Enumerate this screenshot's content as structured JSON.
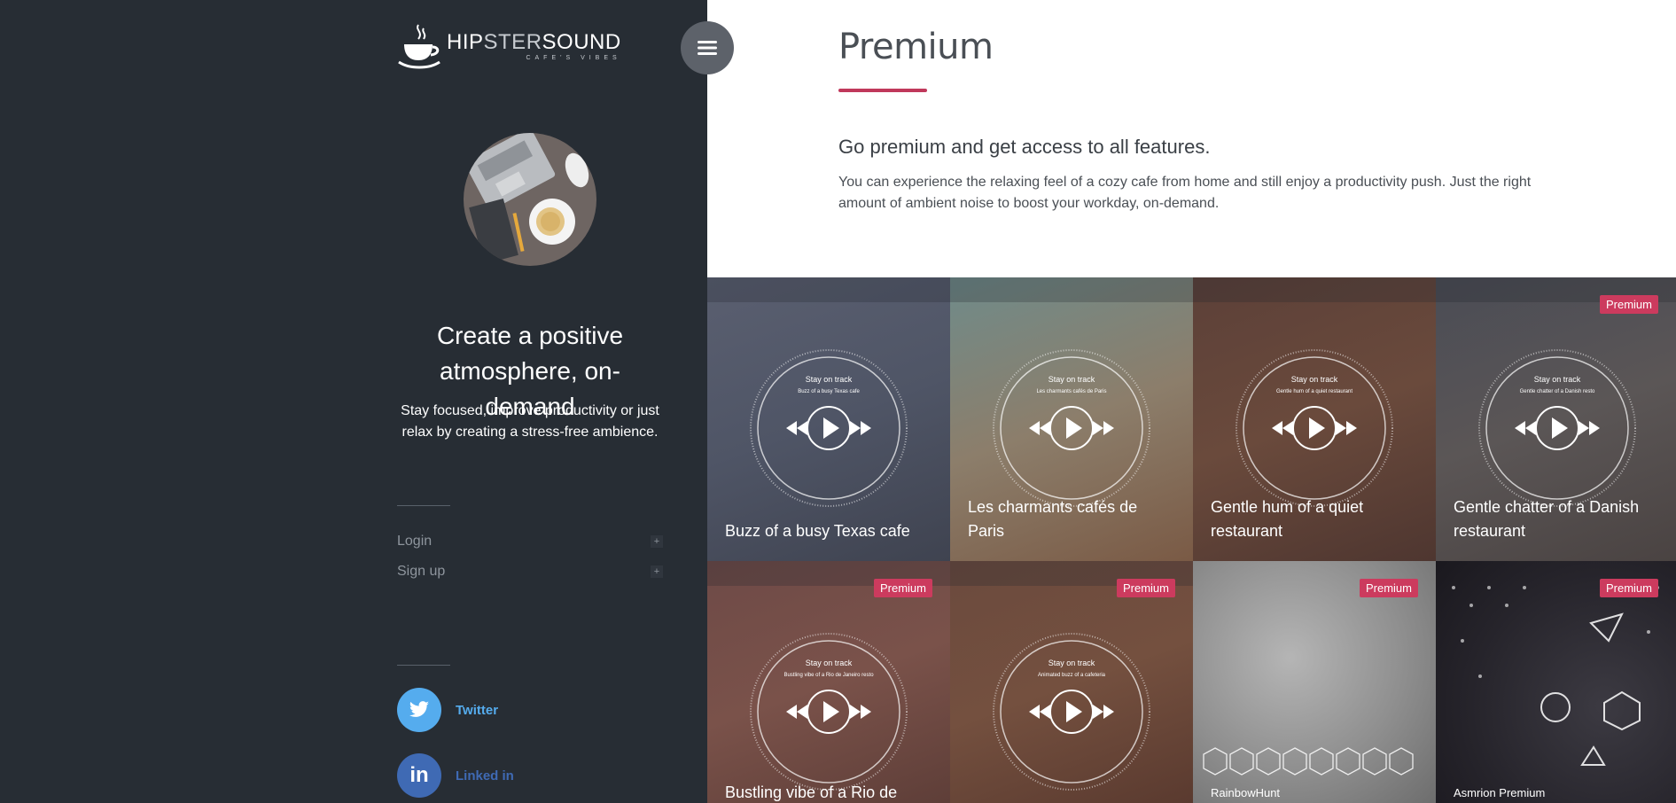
{
  "sidebar": {
    "brand": {
      "name_a": "HIP",
      "name_b": "STER",
      "name_c": "SOUND",
      "tagline": "CAFE'S VIBES"
    },
    "headline": "Create a positive atmosphere, on-demand",
    "subline": "Stay focused, improve productivity or just relax by creating a stress-free ambience.",
    "account": [
      {
        "label": "Login",
        "icon": "plus-icon"
      },
      {
        "label": "Sign up",
        "icon": "plus-icon"
      }
    ],
    "social": [
      {
        "label": "Twitter",
        "icon": "twitter-icon",
        "color": "#55acee"
      },
      {
        "label": "Linked in",
        "icon": "linkedin-icon",
        "color": "#3f6ab4"
      }
    ]
  },
  "main": {
    "title": "Premium",
    "lead": "Go premium and get access to all features.",
    "body": "You can experience the relaxing feel of a cozy cafe from home and still enjoy a productivity push. Just the right amount of ambient noise to boost your workday, on-demand.",
    "accent": "#c0385b",
    "tiles": [
      {
        "title": "Buzz of a busy Texas cafe",
        "player_heading": "Stay on track",
        "player_sub": "Buzz of a busy Texas cafe",
        "badge": ""
      },
      {
        "title": "Les charmants cafés de Paris",
        "player_heading": "Stay on track",
        "player_sub": "Les charmants cafés de Paris",
        "badge": ""
      },
      {
        "title": "Gentle hum of a quiet restaurant",
        "player_heading": "Stay on track",
        "player_sub": "Gentle hum of a quiet restaurant",
        "badge": ""
      },
      {
        "title": "Gentle chatter of a Danish restaurant",
        "player_heading": "Stay on track",
        "player_sub": "Gentle chatter of a Danish resto",
        "badge": "Premium"
      },
      {
        "title": "Bustling vibe of a Rio de",
        "player_heading": "Stay on track",
        "player_sub": "Bustling vibe of a Rio de Janeiro resto",
        "badge": "Premium"
      },
      {
        "title": "",
        "player_heading": "Stay on track",
        "player_sub": "Animated buzz of a cafeteria",
        "badge": "Premium"
      },
      {
        "caption": "RainbowHunt",
        "badge": "Premium"
      },
      {
        "caption": "Asmrion Premium",
        "badge": "Premium"
      }
    ]
  }
}
